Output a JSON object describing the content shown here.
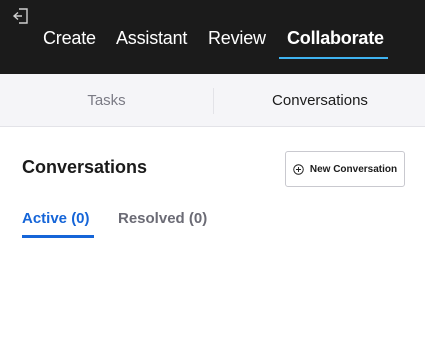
{
  "nav": {
    "tabs": [
      {
        "label": "Create"
      },
      {
        "label": "Assistant"
      },
      {
        "label": "Review"
      },
      {
        "label": "Collaborate",
        "active": true
      }
    ],
    "exit_icon": "exit-icon",
    "active_underline_color": "#3fb3f0",
    "background_color": "#1b1b1b"
  },
  "subtabs": {
    "items": [
      {
        "label": "Tasks"
      },
      {
        "label": "Conversations",
        "active": true
      }
    ]
  },
  "conversations": {
    "title": "Conversations",
    "new_button": {
      "label": "New Conversation",
      "icon": "plus-circle-icon"
    },
    "filters": [
      {
        "label": "Active (0)",
        "active": true
      },
      {
        "label": "Resolved (0)"
      }
    ],
    "accent_color": "#1565d8"
  }
}
